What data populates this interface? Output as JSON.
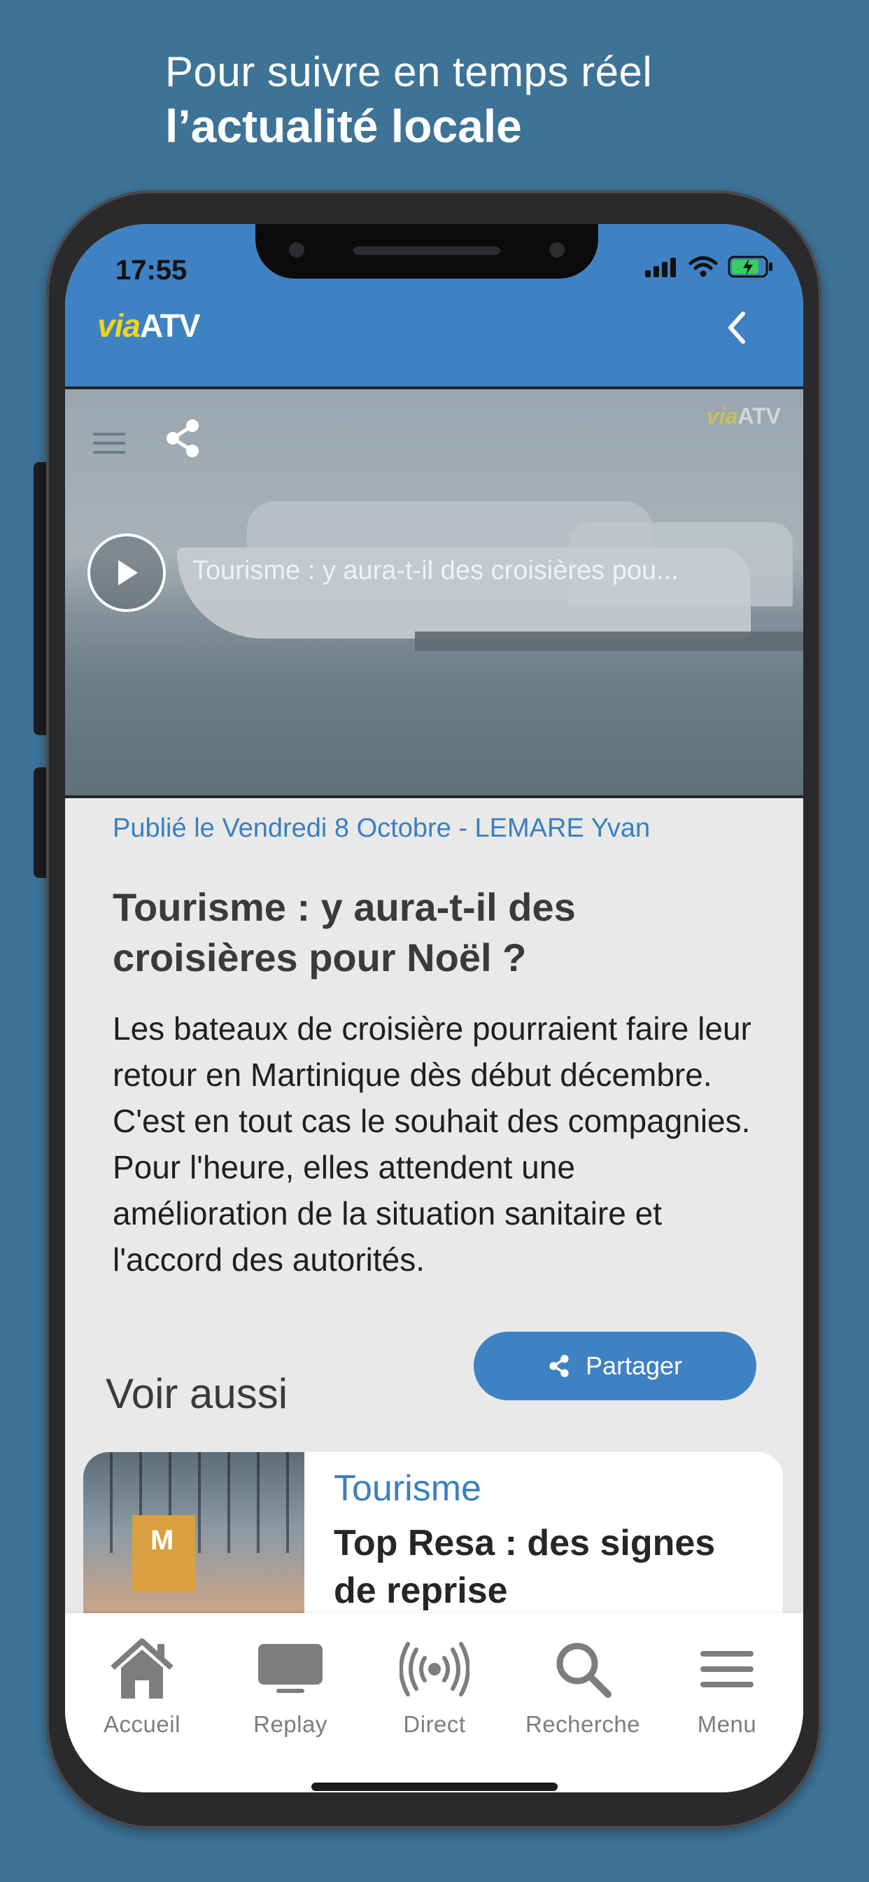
{
  "promo": {
    "line1": "Pour suivre en temps réel",
    "line2": "l’actualité locale"
  },
  "status_bar": {
    "time": "17:55"
  },
  "header": {
    "logo_via": "via",
    "logo_atv": "ATV"
  },
  "video": {
    "logo_via": "via",
    "logo_atv": "ATV",
    "title": "Tourisme : y aura-t-il des croisières pou..."
  },
  "article": {
    "published": "Publié le Vendredi 8 Octobre - LEMARE Yvan",
    "title": "Tourisme : y aura-t-il des croisières pour Noël ?",
    "body": "Les bateaux de croisière pourraient faire leur retour en Martinique dès début décembre. C'est en tout cas le souhait des compagnies. Pour l'heure, elles attendent une amélioration de la situation sanitaire et l'accord des autorités.",
    "share_label": "Partager"
  },
  "see_also": {
    "heading": "Voir aussi",
    "items": [
      {
        "category": "Tourisme",
        "title": "Top Resa : des signes de reprise"
      }
    ]
  },
  "tabbar": {
    "tabs": [
      {
        "label": "Accueil",
        "icon": "home-icon"
      },
      {
        "label": "Replay",
        "icon": "tv-icon"
      },
      {
        "label": "Direct",
        "icon": "broadcast-icon"
      },
      {
        "label": "Recherche",
        "icon": "search-icon"
      },
      {
        "label": "Menu",
        "icon": "menu-icon"
      }
    ]
  },
  "colors": {
    "background": "#3e7398",
    "brand_blue": "#3f82c3",
    "logo_yellow": "#f2d31b"
  }
}
